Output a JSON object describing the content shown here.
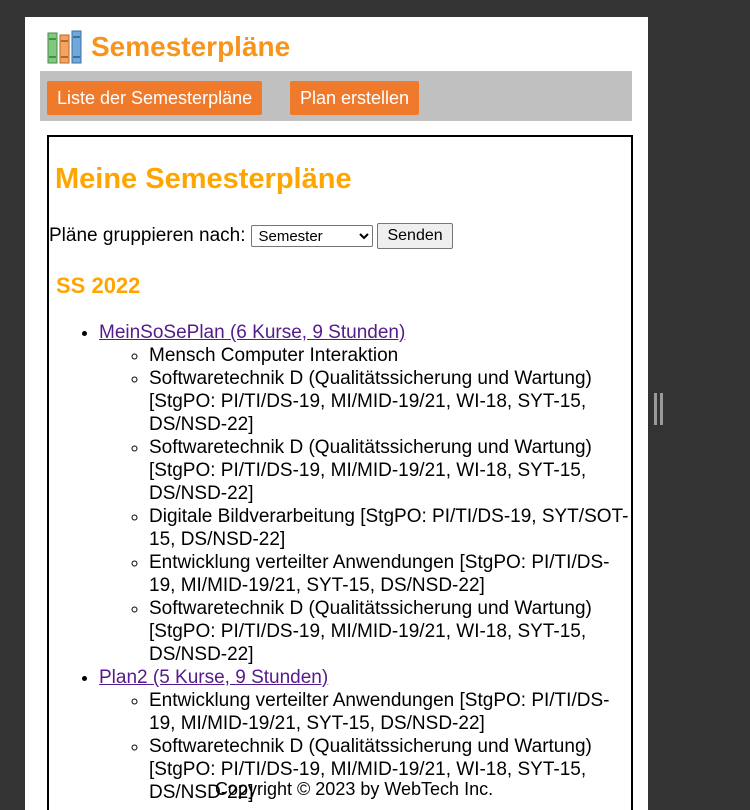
{
  "header": {
    "title": "Semesterpläne",
    "logo_icon": "books-icon"
  },
  "nav": {
    "list_label": "Liste der Semesterpläne",
    "create_label": "Plan erstellen"
  },
  "main": {
    "heading": "Meine Semesterpläne",
    "group_label": "Pläne gruppieren nach:",
    "group_select_value": "Semester",
    "submit_label": "Senden",
    "semester_heading": "SS 2022",
    "plans": [
      {
        "title": "MeinSoSePlan (6 Kurse, 9 Stunden)",
        "courses": [
          "Mensch Computer Interaktion",
          "Softwaretechnik D (Qualitätssicherung und Wartung) [StgPO: PI/TI/DS-19, MI/MID-19/21, WI-18, SYT-15, DS/NSD-22]",
          "Softwaretechnik D (Qualitätssicherung und Wartung) [StgPO: PI/TI/DS-19, MI/MID-19/21, WI-18, SYT-15, DS/NSD-22]",
          "Digitale Bildverarbeitung [StgPO: PI/TI/DS-19, SYT/SOT-15, DS/NSD-22]",
          "Entwicklung verteilter Anwendungen [StgPO: PI/TI/DS-19, MI/MID-19/21, SYT-15, DS/NSD-22]",
          "Softwaretechnik D (Qualitätssicherung und Wartung) [StgPO: PI/TI/DS-19, MI/MID-19/21, WI-18, SYT-15, DS/NSD-22]"
        ]
      },
      {
        "title": "Plan2 (5 Kurse, 9 Stunden)",
        "courses": [
          "Entwicklung verteilter Anwendungen [StgPO: PI/TI/DS-19, MI/MID-19/21, SYT-15, DS/NSD-22]",
          "Softwaretechnik D (Qualitätssicherung und Wartung) [StgPO: PI/TI/DS-19, MI/MID-19/21, WI-18, SYT-15, DS/NSD-22]"
        ]
      }
    ]
  },
  "footer": {
    "copyright": "Copyright © 2023 by WebTech Inc."
  }
}
